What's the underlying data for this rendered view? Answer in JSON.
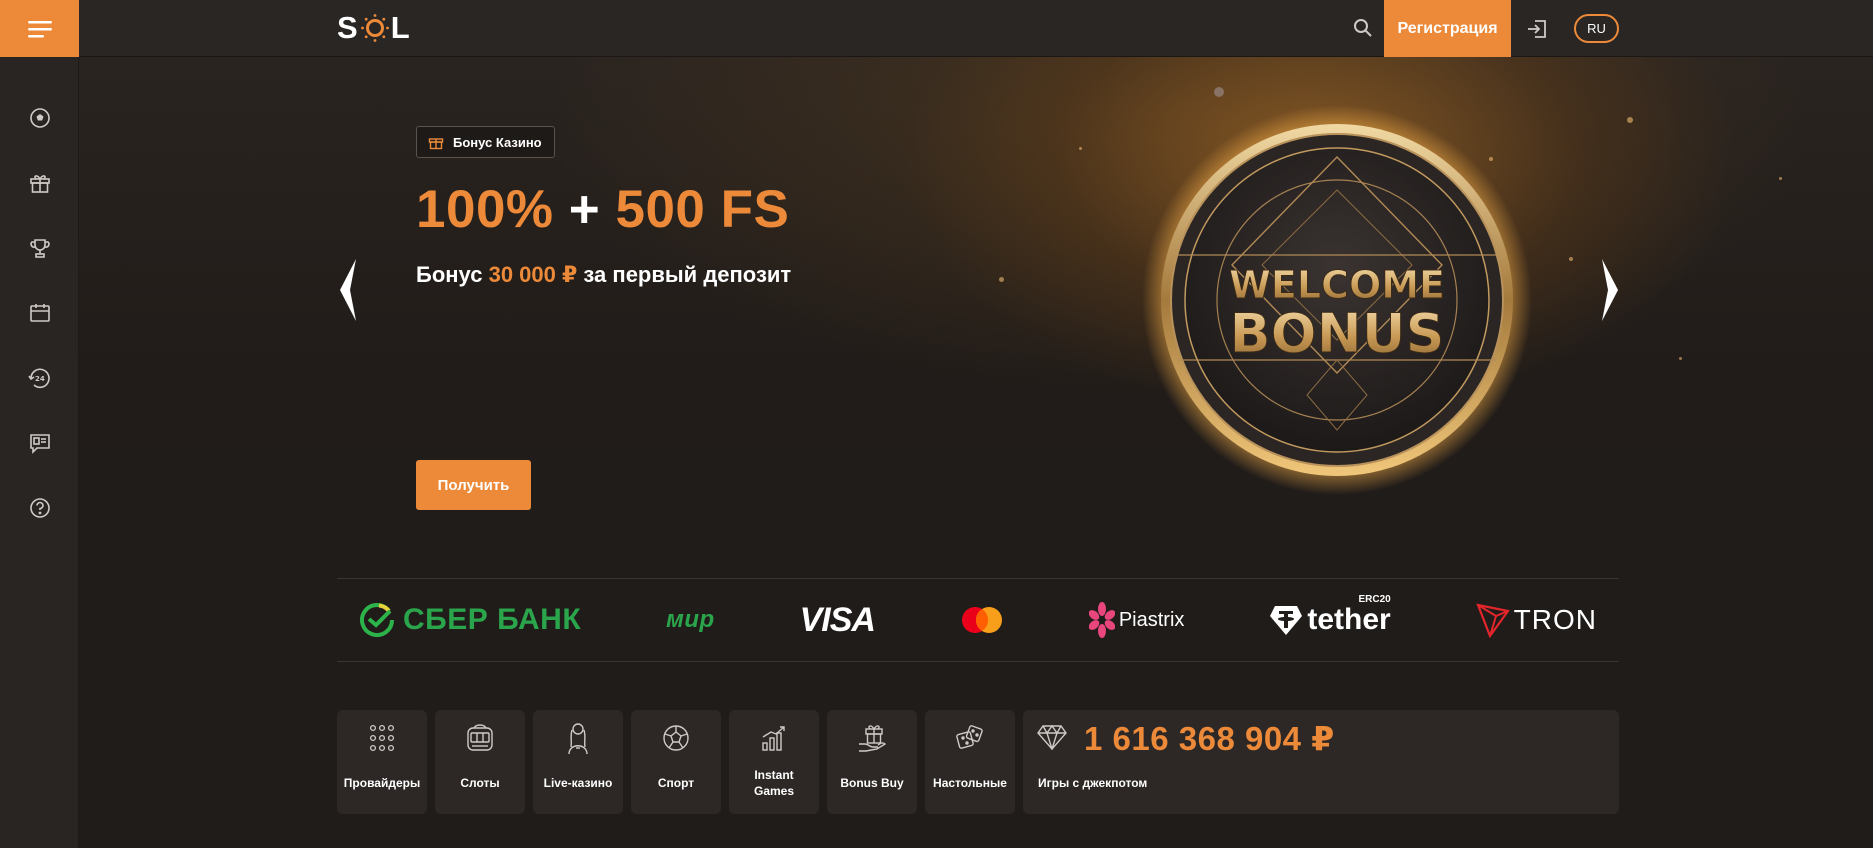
{
  "brand": {
    "logo_left": "S",
    "logo_right": "L",
    "accent": "#ec8a3a"
  },
  "header": {
    "register_label": "Регистрация",
    "lang_label": "RU",
    "icons": [
      "search-icon",
      "login-icon"
    ]
  },
  "sidebar": {
    "items": [
      {
        "icon": "football-icon"
      },
      {
        "icon": "gift-icon"
      },
      {
        "icon": "trophy-icon"
      },
      {
        "icon": "calendar-icon"
      },
      {
        "icon": "support-24-icon"
      },
      {
        "icon": "feedback-icon"
      },
      {
        "icon": "help-icon"
      }
    ]
  },
  "hero": {
    "tag": "Бонус Казино",
    "title_part1": "100%",
    "title_plus": " + ",
    "title_part2": "500 FS",
    "sub_before": "Бонус ",
    "sub_amount": "30 000 ₽",
    "sub_after": " за первый депозит",
    "cta": "Получить",
    "coin_line1": "WELCOME",
    "coin_line2": "BONUS"
  },
  "payments": {
    "sber": "СБЕР БАНК",
    "mir": "мир",
    "visa": "VISA",
    "piastrix": "Piastrix",
    "tether": "tether",
    "tether_tag": "ERC20",
    "tron": "TRON"
  },
  "categories": [
    {
      "label": "Провайдеры",
      "icon": "providers-icon"
    },
    {
      "label": "Слоты",
      "icon": "slots-icon"
    },
    {
      "label": "Live-казино",
      "icon": "live-casino-icon"
    },
    {
      "label": "Спорт",
      "icon": "sport-icon"
    },
    {
      "label": "Instant Games",
      "icon": "instant-games-icon"
    },
    {
      "label": "Bonus Buy",
      "icon": "bonus-buy-icon"
    },
    {
      "label": "Настольные",
      "icon": "table-games-icon"
    }
  ],
  "jackpot": {
    "amount": "1 616 368 904 ₽",
    "label": "Игры с джекпотом"
  }
}
